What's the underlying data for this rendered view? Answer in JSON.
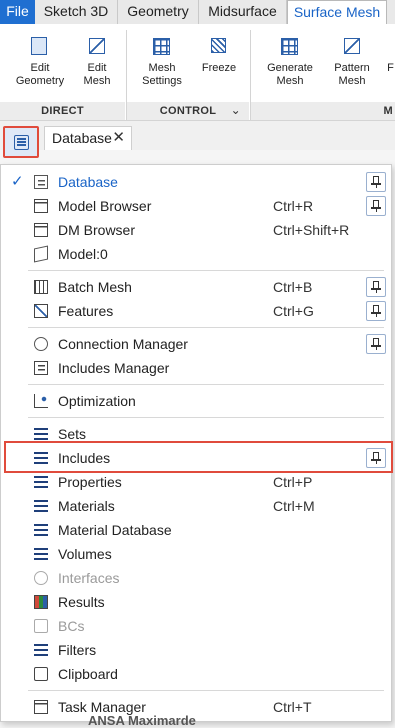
{
  "ribbon_tabs": [
    "File",
    "Sketch 3D",
    "Geometry",
    "Midsurface",
    "Surface Mesh"
  ],
  "ribbon": {
    "buttons": [
      {
        "label": "Edit\nGeometry"
      },
      {
        "label": "Edit\nMesh"
      },
      {
        "label": "Mesh\nSettings"
      },
      {
        "label": "Freeze"
      },
      {
        "label": "Generate\nMesh"
      },
      {
        "label": "Pattern\nMesh"
      },
      {
        "label": "F"
      }
    ],
    "groups": [
      "DIRECT",
      "CONTROL",
      "M"
    ]
  },
  "panel_tab": {
    "label": "Database",
    "close": "✕"
  },
  "menu": {
    "items": [
      {
        "label": "Database",
        "shortcut": "",
        "selected": true,
        "check": "✓"
      },
      {
        "label": "Model Browser",
        "shortcut": "Ctrl+R"
      },
      {
        "label": "DM Browser",
        "shortcut": "Ctrl+Shift+R"
      },
      {
        "label": "Model:0",
        "shortcut": ""
      },
      {
        "label": "Batch Mesh",
        "shortcut": "Ctrl+B"
      },
      {
        "label": "Features",
        "shortcut": "Ctrl+G"
      },
      {
        "label": "Connection Manager",
        "shortcut": ""
      },
      {
        "label": "Includes Manager",
        "shortcut": ""
      },
      {
        "label": "Optimization",
        "shortcut": ""
      },
      {
        "label": "Sets",
        "shortcut": ""
      },
      {
        "label": "Includes",
        "shortcut": ""
      },
      {
        "label": "Properties",
        "shortcut": "Ctrl+P"
      },
      {
        "label": "Materials",
        "shortcut": "Ctrl+M"
      },
      {
        "label": "Material Database",
        "shortcut": ""
      },
      {
        "label": "Volumes",
        "shortcut": ""
      },
      {
        "label": "Interfaces",
        "shortcut": "",
        "disabled": true
      },
      {
        "label": "Results",
        "shortcut": ""
      },
      {
        "label": "BCs",
        "shortcut": "",
        "disabled": true
      },
      {
        "label": "Filters",
        "shortcut": ""
      },
      {
        "label": "Clipboard",
        "shortcut": ""
      },
      {
        "label": "Task Manager",
        "shortcut": "Ctrl+T"
      }
    ]
  },
  "background_text": "ANSA Maximarde",
  "colors": {
    "accent": "#1a64c7",
    "highlight": "#e04b3c",
    "file_tab": "#1f6fd1"
  }
}
